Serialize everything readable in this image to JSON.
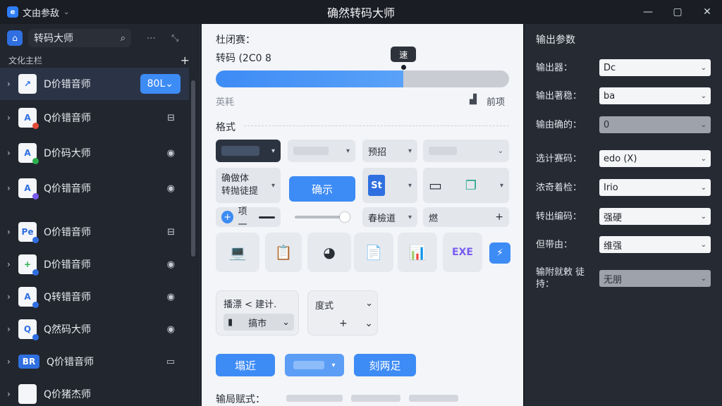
{
  "titlebar": {
    "menu_label": "文由参敌",
    "title": "确然转码大师",
    "controls": {
      "minimize": "—",
      "maximize": "▢",
      "close": "✕"
    }
  },
  "sidebar": {
    "search_text": "转码大师",
    "section_label": "文化主栏",
    "items": [
      {
        "name": "D价错音师",
        "icon_text": "",
        "icon_color": "#2f6fe0",
        "dot_color": "",
        "action": "",
        "badge": "80L",
        "selected": true
      },
      {
        "name": "Q价错音师",
        "icon_text": "A",
        "icon_color": "#2f6fe0",
        "dot_color": "#e24c3b",
        "action": "⊟",
        "badge": ""
      },
      {
        "name": "D价码大师",
        "icon_text": "A",
        "icon_color": "#2f6fe0",
        "dot_color": "#2bb14c",
        "action": "◉",
        "badge": ""
      },
      {
        "name": "Q价错音师",
        "icon_text": "A",
        "icon_color": "#2f6fe0",
        "dot_color": "#7a5cf0",
        "action": "◉",
        "badge": ""
      },
      {
        "name": "O价错音师",
        "icon_text": "Pe",
        "icon_color": "#2f6fe0",
        "dot_color": "#2f6fe0",
        "action": "⊟",
        "badge": ""
      },
      {
        "name": "D价错音师",
        "icon_text": "+",
        "icon_color": "#2bb14c",
        "dot_color": "#2f6fe0",
        "action": "◉",
        "badge": ""
      },
      {
        "name": "Q转错音师",
        "icon_text": "A",
        "icon_color": "#2f6fe0",
        "dot_color": "#2f6fe0",
        "action": "◉",
        "badge": ""
      },
      {
        "name": "Q然码大师",
        "icon_text": "Q",
        "icon_color": "#2f6fe0",
        "dot_color": "#2f6fe0",
        "action": "◉",
        "badge": ""
      },
      {
        "name": "Q价错音师",
        "icon_text": "BR",
        "icon_color": "#ffffff",
        "dot_color": "",
        "action": "▭",
        "badge": "",
        "wide": true
      },
      {
        "name": "Q价猪杰师",
        "icon_text": "",
        "icon_color": "#2f6fe0",
        "dot_color": "",
        "action": "",
        "badge": ""
      }
    ]
  },
  "main": {
    "progress_title": "杜闭赛：",
    "progress_text": "转码 (2C0 8",
    "progress_value": 0.64,
    "tooltip": "速",
    "sub_left": "英耗",
    "sub_right": "前项",
    "format_label": "格式",
    "row1": {
      "c3": "预招"
    },
    "row2": {
      "c1_line1": "确做体",
      "c1_line2": "转抛徒提",
      "c2": "确示",
      "c3": "St"
    },
    "row3": {
      "c1": "项一",
      "c3": "春檢道",
      "c4": "燃"
    },
    "box1": {
      "title": "播漂 < 建计.",
      "select": "搞市"
    },
    "box2": {
      "title": "度式",
      "plus": "+"
    },
    "buttons": {
      "b1": "塌近",
      "b3": "刻两足"
    },
    "footer_label": "输局赋式："
  },
  "right": {
    "title": "输出参数",
    "rows": [
      {
        "label": "输出器：",
        "value": "Dc",
        "disabled": false
      },
      {
        "label": "输出著稳：",
        "value": "ba",
        "disabled": false
      },
      {
        "label": "输由确的：",
        "value": "0",
        "disabled": true
      },
      {
        "label": "选计赛码：",
        "value": "edo (X)",
        "disabled": false
      },
      {
        "label": "浓奇着检：",
        "value": "Irio",
        "disabled": false
      },
      {
        "label": "转出编码：",
        "value": "强硬",
        "disabled": false
      },
      {
        "label": "但带由：",
        "value": "维强",
        "disabled": false
      },
      {
        "label": "输附就敕 徒持：",
        "value": "无朋",
        "disabled": true
      }
    ]
  }
}
